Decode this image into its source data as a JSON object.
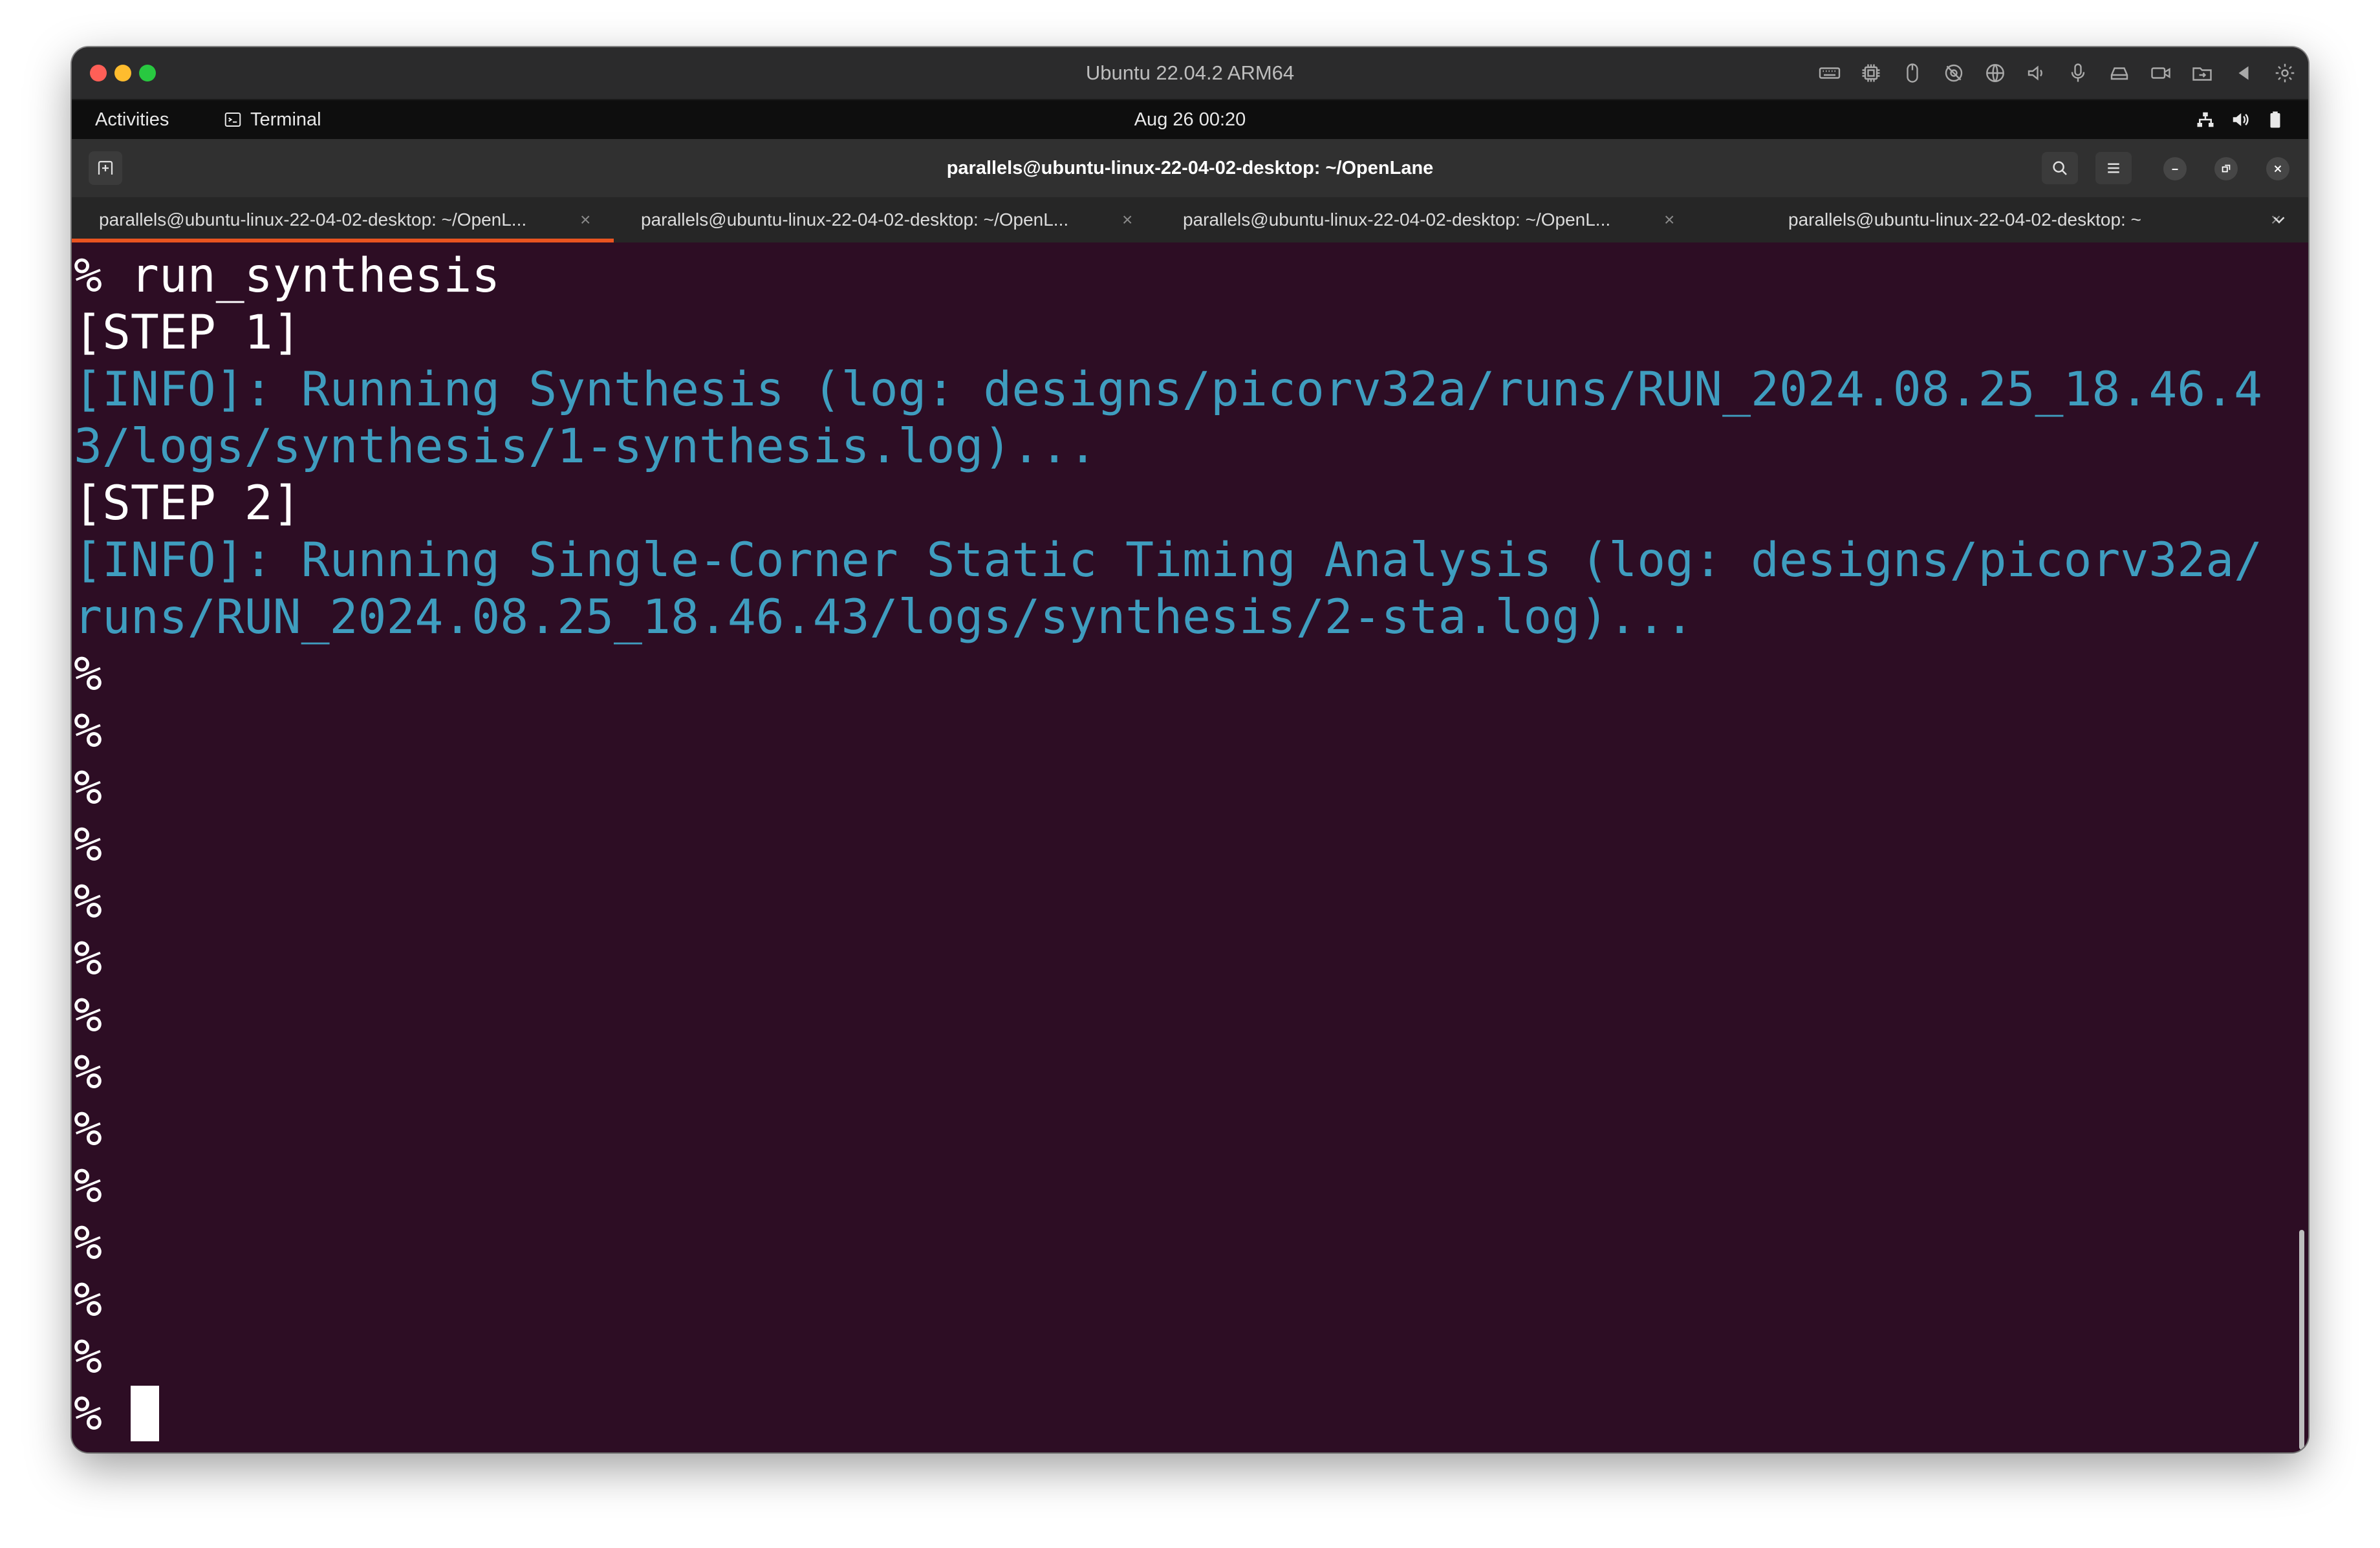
{
  "mac_window": {
    "title": "Ubuntu 22.04.2 ARM64",
    "icons": [
      "keyboard-icon",
      "cpu-icon",
      "mouse-icon",
      "no-camera-icon",
      "globe-icon",
      "speaker-icon",
      "microphone-icon",
      "drive-icon",
      "camera-icon",
      "folder-share-icon",
      "back-arrow-icon",
      "gear-icon"
    ]
  },
  "gnome_bar": {
    "activities": "Activities",
    "app_name": "Terminal",
    "clock": "Aug 26  00:20",
    "tray_icons": [
      "network-icon",
      "volume-icon",
      "battery-icon"
    ]
  },
  "terminal": {
    "title": "parallels@ubuntu-linux-22-04-02-desktop: ~/OpenLane",
    "tabs": [
      {
        "label": "parallels@ubuntu-linux-22-04-02-desktop: ~/OpenL...",
        "close": "×",
        "active": true
      },
      {
        "label": "parallels@ubuntu-linux-22-04-02-desktop: ~/OpenL...",
        "close": "×",
        "active": false
      },
      {
        "label": "parallels@ubuntu-linux-22-04-02-desktop: ~/OpenL...",
        "close": "×",
        "active": false
      },
      {
        "label": "parallels@ubuntu-linux-22-04-02-desktop: ~",
        "close": "×",
        "active": false
      }
    ],
    "lines": [
      {
        "text": "% run_synthesis",
        "kind": "plain"
      },
      {
        "text": "[STEP 1]",
        "kind": "plain"
      },
      {
        "text": "[INFO]: Running Synthesis (log: designs/picorv32a/runs/RUN_2024.08.25_18.46.4",
        "kind": "info"
      },
      {
        "text": "3/logs/synthesis/1-synthesis.log)...",
        "kind": "info"
      },
      {
        "text": "[STEP 2]",
        "kind": "plain"
      },
      {
        "text": "[INFO]: Running Single-Corner Static Timing Analysis (log: designs/picorv32a/",
        "kind": "info"
      },
      {
        "text": "runs/RUN_2024.08.25_18.46.43/logs/synthesis/2-sta.log)...",
        "kind": "info"
      },
      {
        "text": "%",
        "kind": "plain"
      },
      {
        "text": "%",
        "kind": "plain"
      },
      {
        "text": "%",
        "kind": "plain"
      },
      {
        "text": "%",
        "kind": "plain"
      },
      {
        "text": "%",
        "kind": "plain"
      },
      {
        "text": "%",
        "kind": "plain"
      },
      {
        "text": "%",
        "kind": "plain"
      },
      {
        "text": "%",
        "kind": "plain"
      },
      {
        "text": "%",
        "kind": "plain"
      },
      {
        "text": "%",
        "kind": "plain"
      },
      {
        "text": "%",
        "kind": "plain"
      },
      {
        "text": "%",
        "kind": "plain"
      },
      {
        "text": "%",
        "kind": "plain"
      }
    ],
    "prompt": "%",
    "colors": {
      "background": "#2d0d24",
      "info_text": "#3f9dbf",
      "plain_text": "#ffffff",
      "active_tab_accent": "#e95420"
    }
  }
}
